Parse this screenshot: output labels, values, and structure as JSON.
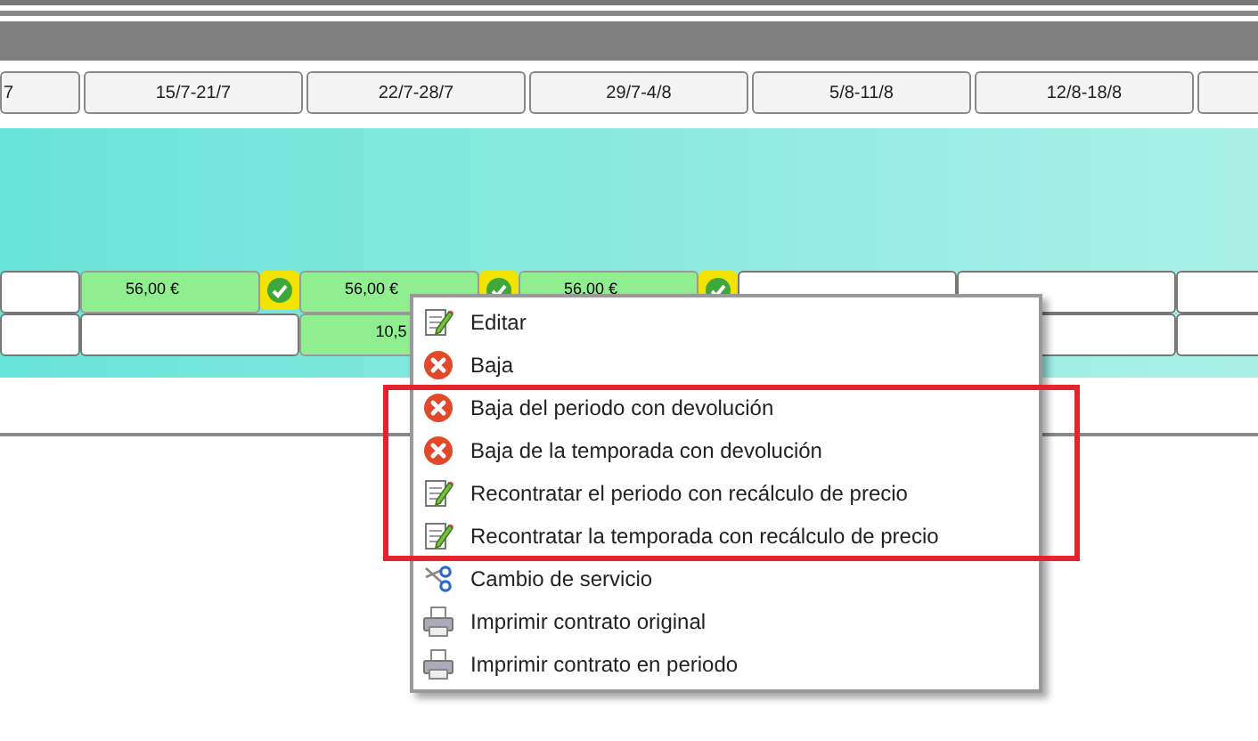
{
  "columns": [
    {
      "label": "7"
    },
    {
      "label": "15/7-21/7"
    },
    {
      "label": "22/7-28/7"
    },
    {
      "label": "29/7-4/8"
    },
    {
      "label": "5/8-11/8"
    },
    {
      "label": "12/8-18/8"
    },
    {}
  ],
  "rows": [
    {
      "cells": [
        {
          "filled": false
        },
        {
          "filled": true,
          "price": "56,00 €",
          "confirmed": true
        },
        {
          "filled": true,
          "price": "56,00 €",
          "confirmed": true
        },
        {
          "filled": true,
          "price": "56,00 €",
          "confirmed": true
        },
        {
          "filled": false
        },
        {
          "filled": false
        },
        {
          "filled": false
        }
      ]
    },
    {
      "cells": [
        {
          "filled": false
        },
        {
          "filled": false
        },
        {
          "filled": true,
          "price": "10,5"
        },
        {},
        {},
        {
          "filled": false
        },
        {
          "filled": false
        }
      ]
    }
  ],
  "context_menu": {
    "sections": [
      {
        "highlighted": false,
        "items": [
          {
            "kind": "edit",
            "label": "Editar"
          },
          {
            "kind": "remove",
            "label": "Baja"
          }
        ]
      },
      {
        "highlighted": true,
        "items": [
          {
            "kind": "remove",
            "label": "Baja del periodo con devolución"
          },
          {
            "kind": "remove",
            "label": "Baja de la temporada con devolución"
          },
          {
            "kind": "edit",
            "label": "Recontratar el periodo con recálculo de precio"
          },
          {
            "kind": "edit",
            "label": "Recontratar la temporada con recálculo de precio"
          }
        ]
      },
      {
        "highlighted": false,
        "items": [
          {
            "kind": "cut",
            "label": "Cambio de servicio"
          },
          {
            "kind": "print",
            "label": "Imprimir contrato original"
          },
          {
            "kind": "print",
            "label": "Imprimir contrato en periodo"
          }
        ]
      }
    ]
  }
}
